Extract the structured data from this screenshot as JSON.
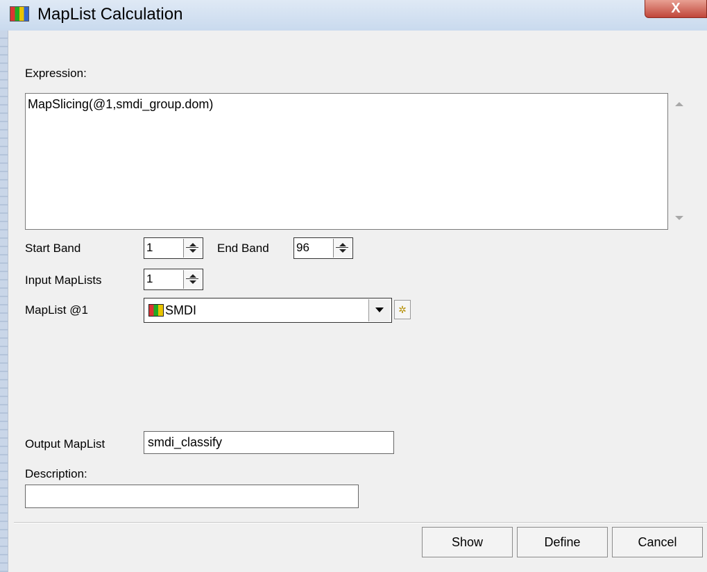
{
  "window": {
    "title": "MapList Calculation",
    "close_glyph": "X",
    "icon": "maplist-icon"
  },
  "expression": {
    "label": "Expression:",
    "value": "MapSlicing(@1,smdi_group.dom)"
  },
  "start_band": {
    "label": "Start Band",
    "value": "1"
  },
  "end_band": {
    "label": "End Band",
    "value": "96"
  },
  "input_maplists": {
    "label": "Input MapLists",
    "value": "1"
  },
  "maplist1": {
    "label": "MapList @1",
    "selected": "SMDI",
    "icon": "maplist-icon",
    "props_icon": "properties-icon"
  },
  "output_maplist": {
    "label": "Output MapList",
    "value": "smdi_classify"
  },
  "description": {
    "label": "Description:",
    "value": ""
  },
  "buttons": {
    "show": "Show",
    "define": "Define",
    "cancel": "Cancel"
  }
}
